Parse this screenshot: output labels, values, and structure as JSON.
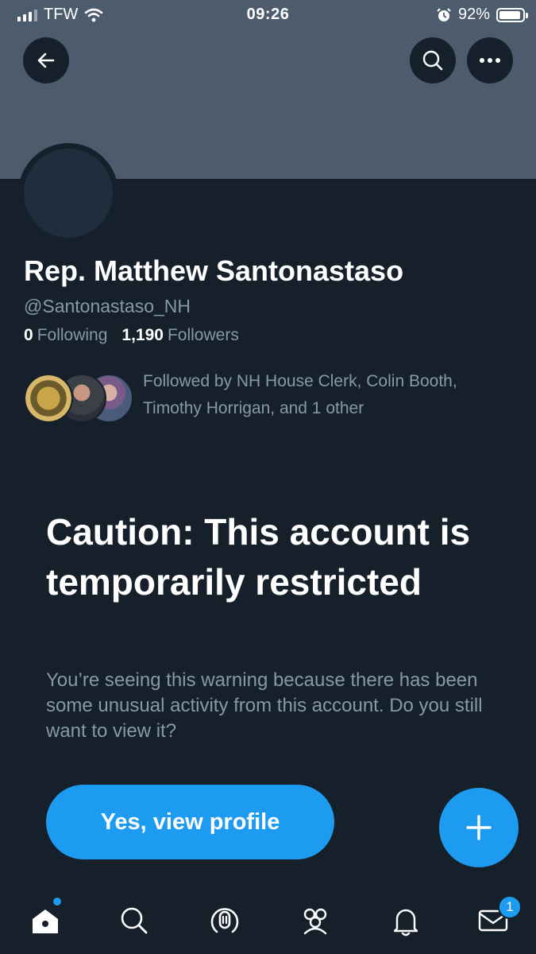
{
  "status_bar": {
    "carrier": "TFW",
    "time": "09:26",
    "battery_percent": "92%",
    "battery_level": 0.92,
    "icons": [
      "signal-icon",
      "wifi-icon",
      "alarm-icon",
      "battery-icon"
    ]
  },
  "header": {
    "icons": [
      "back-arrow-icon",
      "search-icon",
      "more-icon"
    ],
    "banner_color": "#4c5c6d"
  },
  "profile": {
    "display_name": "Rep. Matthew Santonastaso",
    "handle": "@Santonastaso_NH",
    "following_count": "0",
    "following_label": "Following",
    "followers_count": "1,190",
    "followers_label": "Followers",
    "followed_by_text": "Followed by NH House Clerk, Colin Booth, Timothy Horrigan, and 1 other"
  },
  "warning": {
    "title": "Caution: This account is temporarily restricted",
    "body": "You’re seeing this warning because there has been some unusual activity from this account. Do you still want to view it?",
    "button_label": "Yes, view profile"
  },
  "fab": {
    "icon": "plus-icon"
  },
  "tabbar": {
    "items": [
      {
        "name": "home",
        "icon": "home-icon",
        "has_dot": true
      },
      {
        "name": "search",
        "icon": "search-icon"
      },
      {
        "name": "spaces",
        "icon": "spaces-icon"
      },
      {
        "name": "communities",
        "icon": "communities-icon"
      },
      {
        "name": "notifications",
        "icon": "bell-icon"
      },
      {
        "name": "messages",
        "icon": "mail-icon",
        "badge": "1"
      }
    ]
  },
  "colors": {
    "background": "#15202b",
    "accent": "#1d9bf0",
    "secondary_text": "#8899a6"
  }
}
